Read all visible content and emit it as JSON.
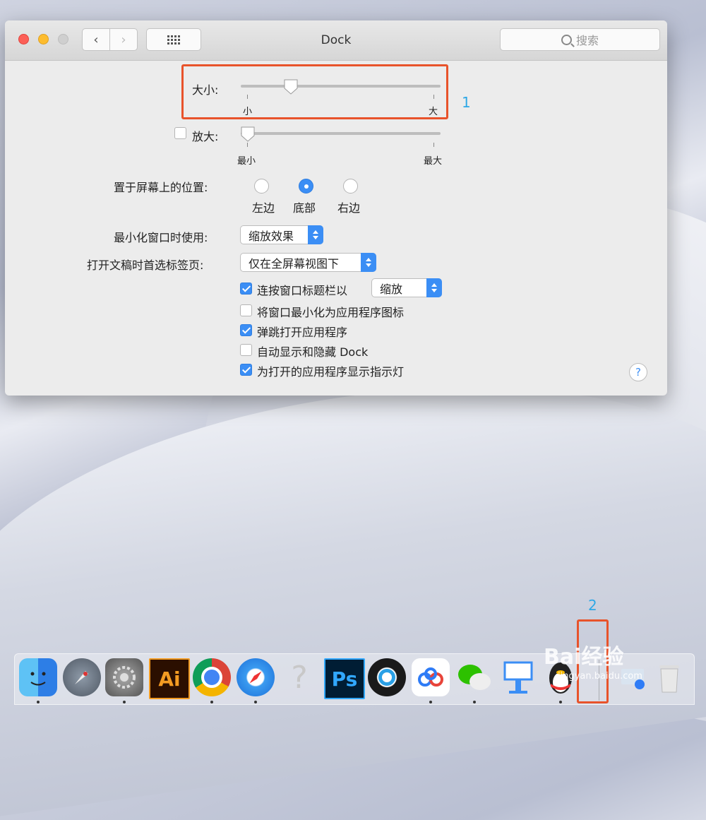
{
  "window": {
    "title": "Dock",
    "search_placeholder": "搜索",
    "nav_back": "‹",
    "nav_forward": "›"
  },
  "size": {
    "label": "大小:",
    "min_label": "小",
    "max_label": "大",
    "value": 0.25
  },
  "magnification": {
    "label": "放大:",
    "checked": false,
    "min_label": "最小",
    "max_label": "最大",
    "value": 0.0
  },
  "position": {
    "label": "置于屏幕上的位置:",
    "options": [
      "左边",
      "底部",
      "右边"
    ],
    "selected": "底部"
  },
  "minimize": {
    "label": "最小化窗口时使用:",
    "value": "缩放效果"
  },
  "tabs_pref": {
    "label": "打开文稿时首选标签页:",
    "value": "仅在全屏幕视图下"
  },
  "checkboxes": [
    {
      "label": "连按窗口标题栏以",
      "checked": true,
      "popup_value": "缩放"
    },
    {
      "label": "将窗口最小化为应用程序图标",
      "checked": false
    },
    {
      "label": "弹跳打开应用程序",
      "checked": true
    },
    {
      "label": "自动显示和隐藏 Dock",
      "checked": false
    },
    {
      "label": "为打开的应用程序显示指示灯",
      "checked": true
    }
  ],
  "help": "?",
  "annotations": [
    "1",
    "2"
  ],
  "dock": {
    "apps": [
      "finder",
      "launchpad",
      "system-preferences",
      "illustrator",
      "chrome",
      "safari",
      "unknown-app",
      "photoshop",
      "quicktime",
      "baidu-netdisk",
      "wechat",
      "keynote",
      "qq"
    ],
    "ai_label": "Ai",
    "ps_label": "Ps",
    "unknown_label": "?"
  },
  "watermark": {
    "brand": "Bai经验",
    "url": "jingyan.baidu.com"
  },
  "colors": {
    "accent": "#3b8ef5",
    "highlight": "#e8532b",
    "annotation": "#2ea8e6"
  }
}
